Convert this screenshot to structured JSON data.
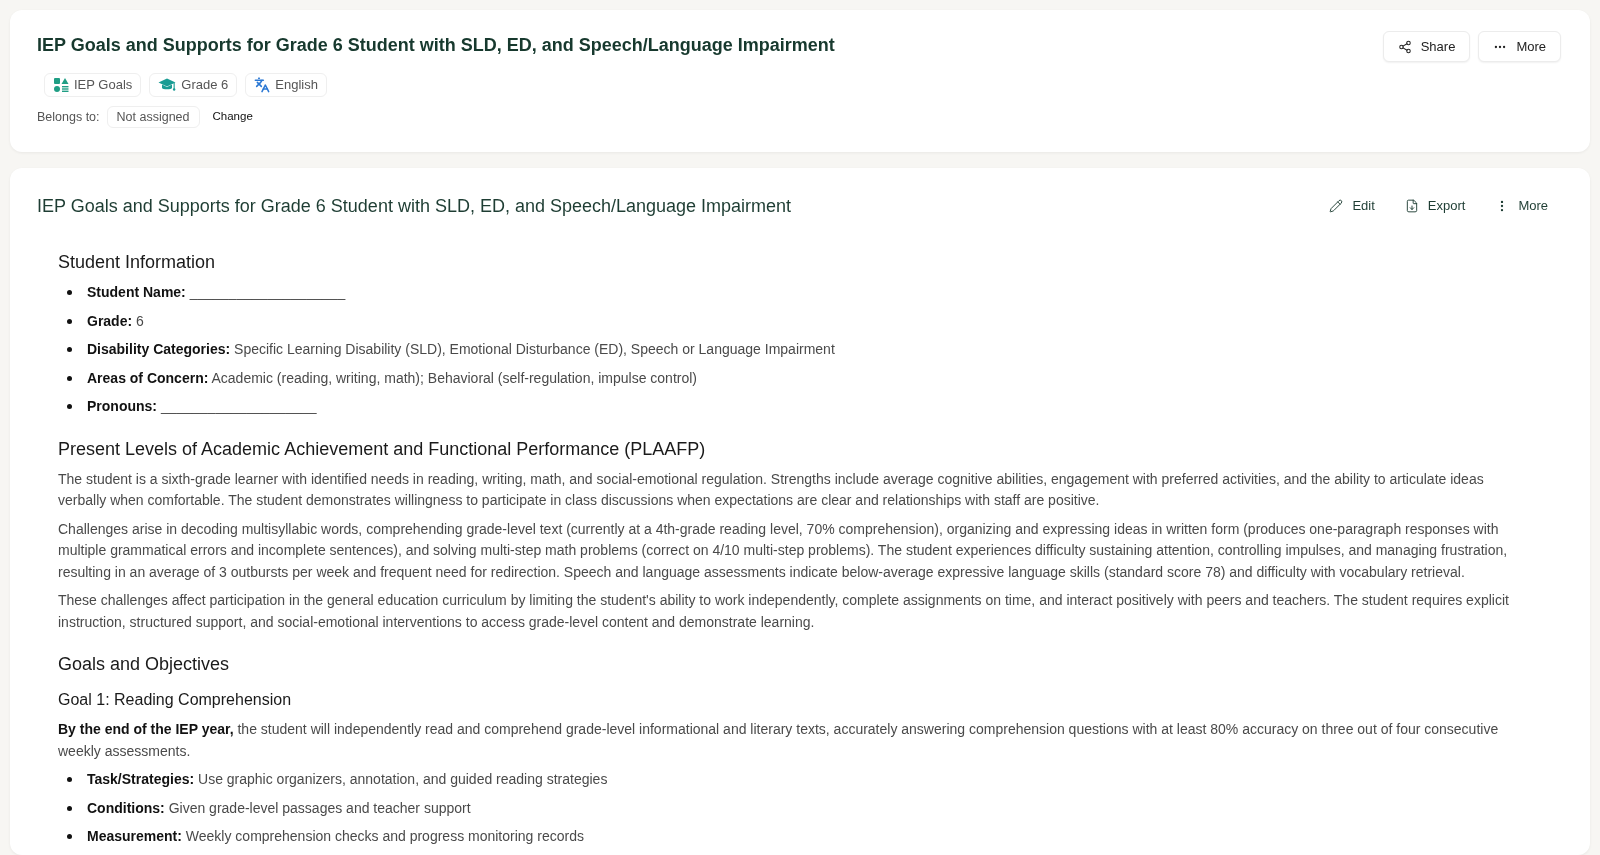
{
  "header": {
    "title": "IEP Goals and Supports for Grade 6 Student with SLD, ED, and Speech/Language Impairment",
    "tags": [
      {
        "kind": "category",
        "label": "IEP Goals"
      },
      {
        "kind": "grade",
        "label": "Grade 6"
      },
      {
        "kind": "language",
        "label": "English"
      }
    ],
    "belongs_to": {
      "label": "Belongs to:",
      "value": "Not assigned",
      "action": "Change"
    },
    "actions": [
      {
        "kind": "share",
        "label": "Share"
      },
      {
        "kind": "more",
        "label": "More"
      }
    ]
  },
  "document": {
    "title": "IEP Goals and Supports for Grade 6 Student with SLD, ED, and Speech/Language Impairment",
    "actions": [
      {
        "kind": "edit",
        "label": "Edit"
      },
      {
        "kind": "export",
        "label": "Export"
      },
      {
        "kind": "more",
        "label": "More"
      }
    ],
    "blocks": [
      {
        "kind": "heading",
        "text": "Student Information"
      },
      {
        "kind": "list",
        "items": [
          {
            "label": "Student Name:",
            "value": "____________________"
          },
          {
            "label": "Grade:",
            "value": "6"
          },
          {
            "label": "Disability Categories:",
            "value": "Specific Learning Disability (SLD), Emotional Disturbance (ED), Speech or Language Impairment"
          },
          {
            "label": "Areas of Concern:",
            "value": "Academic (reading, writing, math); Behavioral (self-regulation, impulse control)"
          },
          {
            "label": "Pronouns:",
            "value": "____________________"
          }
        ]
      },
      {
        "kind": "heading",
        "text": "Present Levels of Academic Achievement and Functional Performance (PLAAFP)"
      },
      {
        "kind": "paragraph",
        "text": "The student is a sixth-grade learner with identified needs in reading, writing, math, and social-emotional regulation. Strengths include average cognitive abilities, engagement with preferred activities, and the ability to articulate ideas verbally when comfortable. The student demonstrates willingness to participate in class discussions when expectations are clear and relationships with staff are positive."
      },
      {
        "kind": "paragraph",
        "text": "Challenges arise in decoding multisyllabic words, comprehending grade-level text (currently at a 4th-grade reading level, 70% comprehension), organizing and expressing ideas in written form (produces one-paragraph responses with multiple grammatical errors and incomplete sentences), and solving multi-step math problems (correct on 4/10 multi-step problems). The student experiences difficulty sustaining attention, controlling impulses, and managing frustration, resulting in an average of 3 outbursts per week and frequent need for redirection. Speech and language assessments indicate below-average expressive language skills (standard score 78) and difficulty with vocabulary retrieval."
      },
      {
        "kind": "paragraph",
        "text": "These challenges affect participation in the general education curriculum by limiting the student's ability to work independently, complete assignments on time, and interact positively with peers and teachers. The student requires explicit instruction, structured support, and social-emotional interventions to access grade-level content and demonstrate learning."
      },
      {
        "kind": "heading",
        "text": "Goals and Objectives"
      },
      {
        "kind": "subheading",
        "text": "Goal 1: Reading Comprehension"
      },
      {
        "kind": "paragraph",
        "text": "**By the end of the IEP year,** the student will independently read and comprehend grade-level informational and literary texts, accurately answering comprehension questions with at least 80% accuracy on three out of four consecutive weekly assessments."
      },
      {
        "kind": "list",
        "items": [
          {
            "label": "Task/Strategies:",
            "value": "Use graphic organizers, annotation, and guided reading strategies"
          },
          {
            "label": "Conditions:",
            "value": "Given grade-level passages and teacher support"
          },
          {
            "label": "Measurement:",
            "value": "Weekly comprehension checks and progress monitoring records"
          }
        ]
      }
    ]
  }
}
